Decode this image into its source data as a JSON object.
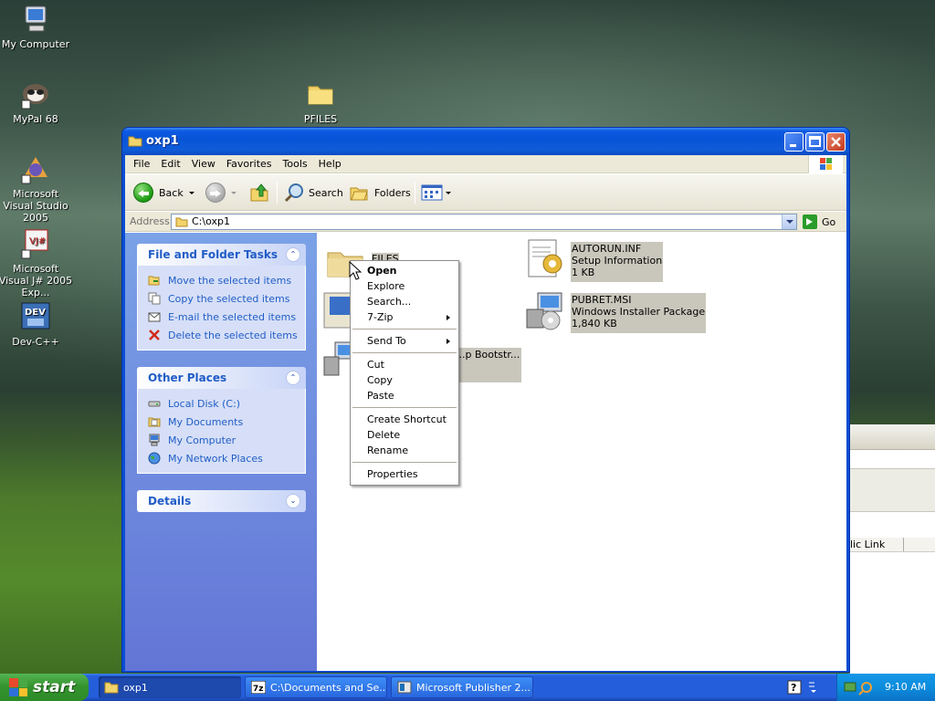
{
  "desktop": {
    "icons": [
      {
        "label": "My Computer"
      },
      {
        "label": "MyPal 68"
      },
      {
        "label": "Microsoft Visual Studio 2005"
      },
      {
        "label": "Microsoft Visual J# 2005 Exp..."
      },
      {
        "label": "Dev-C++"
      },
      {
        "label": "PFILES"
      }
    ]
  },
  "window": {
    "title": "oxp1",
    "menu": [
      "File",
      "Edit",
      "View",
      "Favorites",
      "Tools",
      "Help"
    ],
    "toolbar": {
      "back": "Back",
      "search": "Search",
      "folders": "Folders"
    },
    "address": {
      "label": "Address",
      "value": "C:\\oxp1",
      "go": "Go"
    }
  },
  "taskpane": {
    "file_tasks": {
      "title": "File and Folder Tasks",
      "items": [
        "Move the selected items",
        "Copy the selected items",
        "E-mail the selected items",
        "Delete the selected items"
      ]
    },
    "other_places": {
      "title": "Other Places",
      "items": [
        "Local Disk (C:)",
        "My Documents",
        "My Computer",
        "My Network Places"
      ]
    },
    "details": {
      "title": "Details"
    }
  },
  "files": [
    {
      "name": "FILES",
      "type": "",
      "size": ""
    },
    {
      "name": "AUTORUN.INF",
      "type": "Setup Information",
      "size": "1 KB"
    },
    {
      "name": "PUBRET.MSI",
      "type": "Windows Installer Package",
      "size": "1,840 KB"
    },
    {
      "name": "...p Bootstr...",
      "type": "",
      "size": ""
    }
  ],
  "context_menu": {
    "items": [
      "Open",
      "Explore",
      "Search...",
      "7-Zip",
      "Send To",
      "Cut",
      "Copy",
      "Paste",
      "Create Shortcut",
      "Delete",
      "Rename",
      "Properties"
    ]
  },
  "background_window": {
    "column_label": "lic Link"
  },
  "taskbar": {
    "start": "start",
    "tasks": [
      "oxp1",
      "C:\\Documents and Se...",
      "Microsoft Publisher 2..."
    ],
    "clock": "9:10 AM"
  },
  "colors": {
    "taskbar": "#245edb",
    "start": "#36942f",
    "taskpane": "#7ba2e7",
    "selection": "#c9c7bc"
  }
}
